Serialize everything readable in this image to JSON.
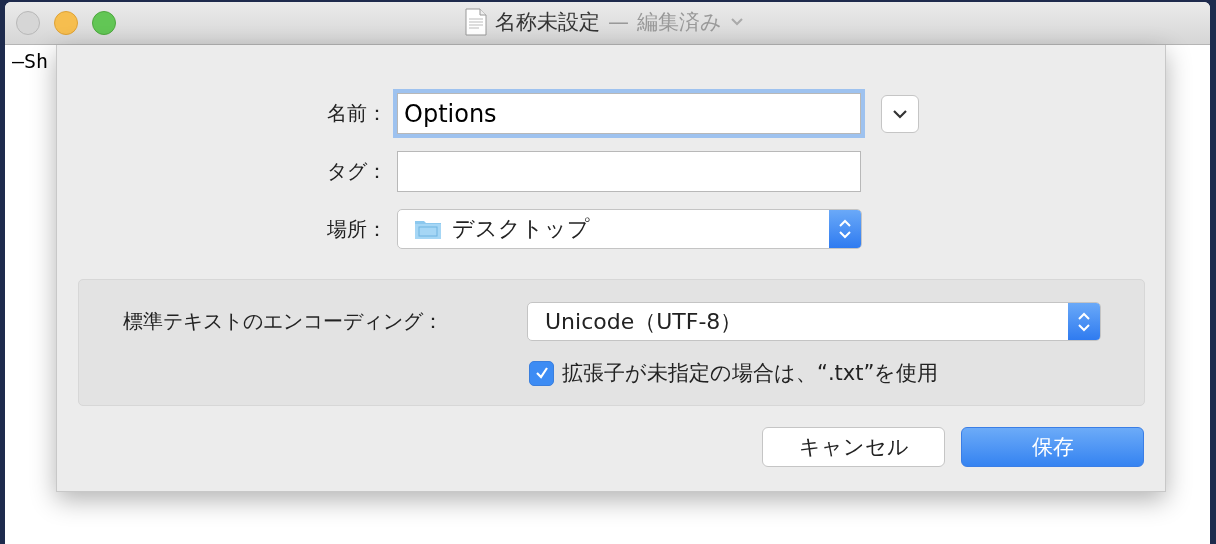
{
  "window": {
    "title": "名称未設定",
    "separator": "—",
    "status": "編集済み"
  },
  "editor": {
    "text": "–Sh"
  },
  "save_sheet": {
    "name_label": "名前：",
    "name_value": "Options",
    "name_focused": true,
    "expanded": false,
    "tags_label": "タグ：",
    "location_label": "場所：",
    "location_value": "デスクトップ",
    "encoding_label": "標準テキストのエンコーディング：",
    "encoding_value": "Unicode（UTF-8）",
    "extension_checkbox": {
      "label": "拡張子が未指定の場合は、“.txt”を使用",
      "checked": true
    },
    "buttons": [
      {
        "label": "キャンセル",
        "kind": "cancel"
      },
      {
        "label": "保存",
        "kind": "default"
      }
    ]
  }
}
